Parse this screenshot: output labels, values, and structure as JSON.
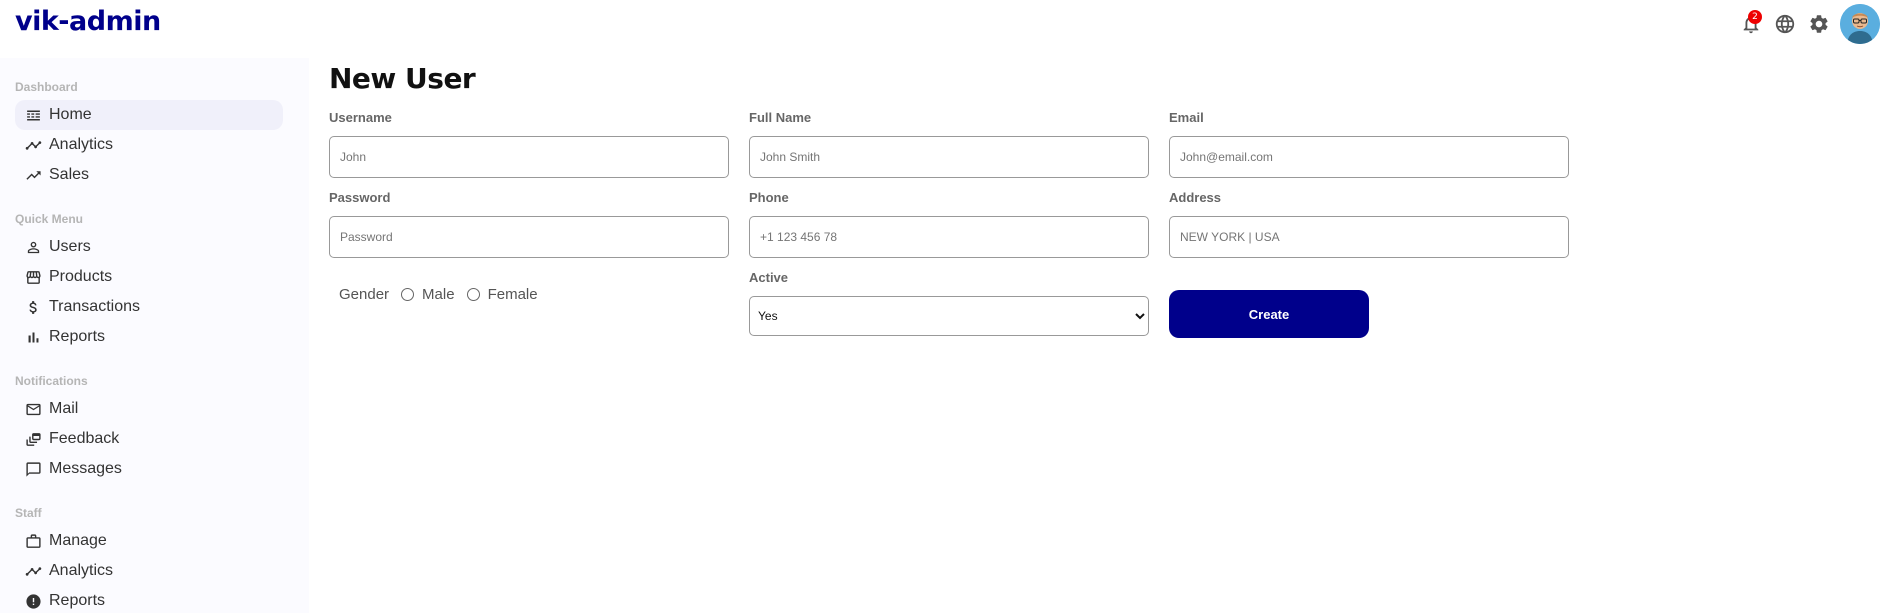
{
  "app": {
    "title": "vik-admin"
  },
  "topbar": {
    "notification_count": "2",
    "icons": [
      "bell-icon",
      "globe-icon",
      "gear-icon"
    ]
  },
  "sidebar": {
    "sections": [
      {
        "title": "Dashboard",
        "items": [
          {
            "label": "Home",
            "icon": "home-icon",
            "active": true
          },
          {
            "label": "Analytics",
            "icon": "timeline-icon"
          },
          {
            "label": "Sales",
            "icon": "trending-up-icon"
          }
        ]
      },
      {
        "title": "Quick Menu",
        "items": [
          {
            "label": "Users",
            "icon": "person-icon"
          },
          {
            "label": "Products",
            "icon": "storefront-icon"
          },
          {
            "label": "Transactions",
            "icon": "dollar-icon"
          },
          {
            "label": "Reports",
            "icon": "bar-chart-icon"
          }
        ]
      },
      {
        "title": "Notifications",
        "items": [
          {
            "label": "Mail",
            "icon": "mail-icon"
          },
          {
            "label": "Feedback",
            "icon": "dynamic-feed-icon"
          },
          {
            "label": "Messages",
            "icon": "chat-bubble-icon"
          }
        ]
      },
      {
        "title": "Staff",
        "items": [
          {
            "label": "Manage",
            "icon": "work-icon"
          },
          {
            "label": "Analytics",
            "icon": "timeline-icon"
          },
          {
            "label": "Reports",
            "icon": "report-icon"
          }
        ]
      }
    ]
  },
  "page": {
    "title": "New User"
  },
  "form": {
    "username": {
      "label": "Username",
      "placeholder": "John"
    },
    "full_name": {
      "label": "Full Name",
      "placeholder": "John Smith"
    },
    "email": {
      "label": "Email",
      "placeholder": "John@email.com"
    },
    "password": {
      "label": "Password",
      "placeholder": "Password"
    },
    "phone": {
      "label": "Phone",
      "placeholder": "+1 123 456 78"
    },
    "address": {
      "label": "Address",
      "placeholder": "NEW YORK | USA"
    },
    "gender": {
      "label": "Gender",
      "options": [
        "Male",
        "Female"
      ]
    },
    "active": {
      "label": "Active",
      "selected": "Yes"
    },
    "create_label": "Create"
  },
  "colors": {
    "brand": "#00008b",
    "badge": "#ee0000",
    "sidebar_bg": "#fbfbff"
  }
}
